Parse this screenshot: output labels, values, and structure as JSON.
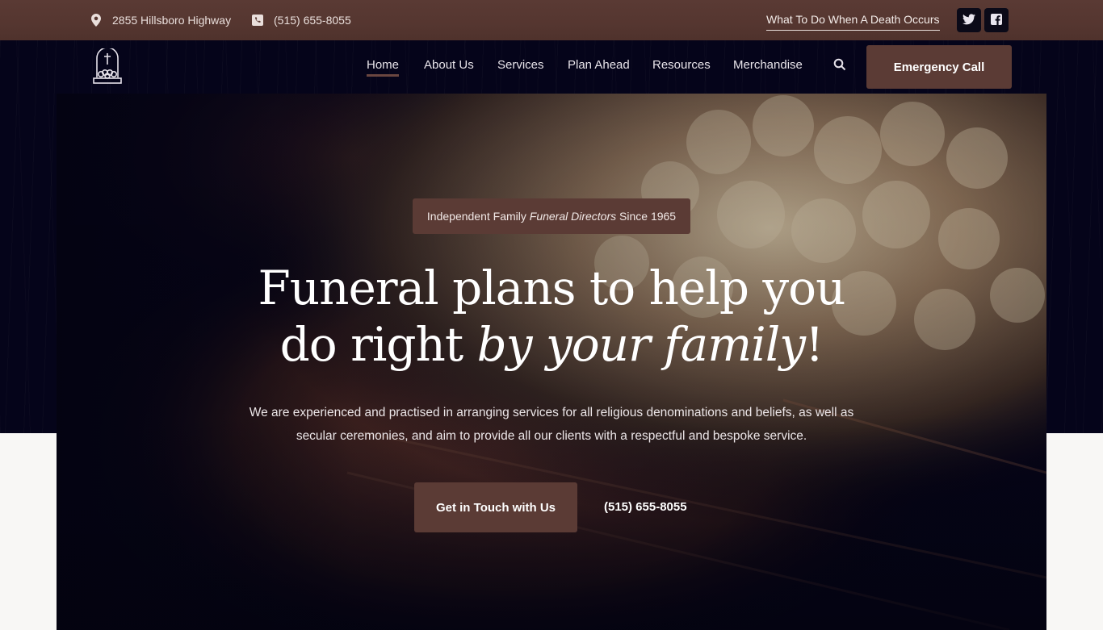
{
  "topbar": {
    "address": "2855 Hillsboro Highway",
    "phone": "(515) 655-8055",
    "death_link": "What To Do When A Death Occurs",
    "social": [
      {
        "name": "twitter",
        "icon": "twitter-icon"
      },
      {
        "name": "facebook",
        "icon": "facebook-icon"
      }
    ]
  },
  "header": {
    "logo_icon": "tombstone-icon",
    "nav": [
      {
        "label": "Home",
        "active": true
      },
      {
        "label": "About Us"
      },
      {
        "label": "Services"
      },
      {
        "label": "Plan Ahead"
      },
      {
        "label": "Resources"
      },
      {
        "label": "Merchandise"
      }
    ],
    "search_icon": "search-icon",
    "emergency_label": "Emergency Call"
  },
  "hero": {
    "badge_pre": "Independent Family ",
    "badge_em": "Funeral Directors",
    "badge_post": " Since 1965",
    "headline_line1": "Funeral plans to help you",
    "headline_line2_pre": "do right ",
    "headline_line2_em": "by your family",
    "headline_line2_post": "!",
    "lead": "We are experienced and practised in arranging services for all religious denominations and beliefs, as well as secular ceremonies, and aim to provide all our clients with a respectful and bespoke service.",
    "cta_label": "Get in Touch with Us",
    "cta_phone": "(515) 655-8055"
  },
  "colors": {
    "brand_brown": "#5b3b35",
    "dark_navy": "#05041a",
    "light_bg": "#f8f7f5"
  }
}
